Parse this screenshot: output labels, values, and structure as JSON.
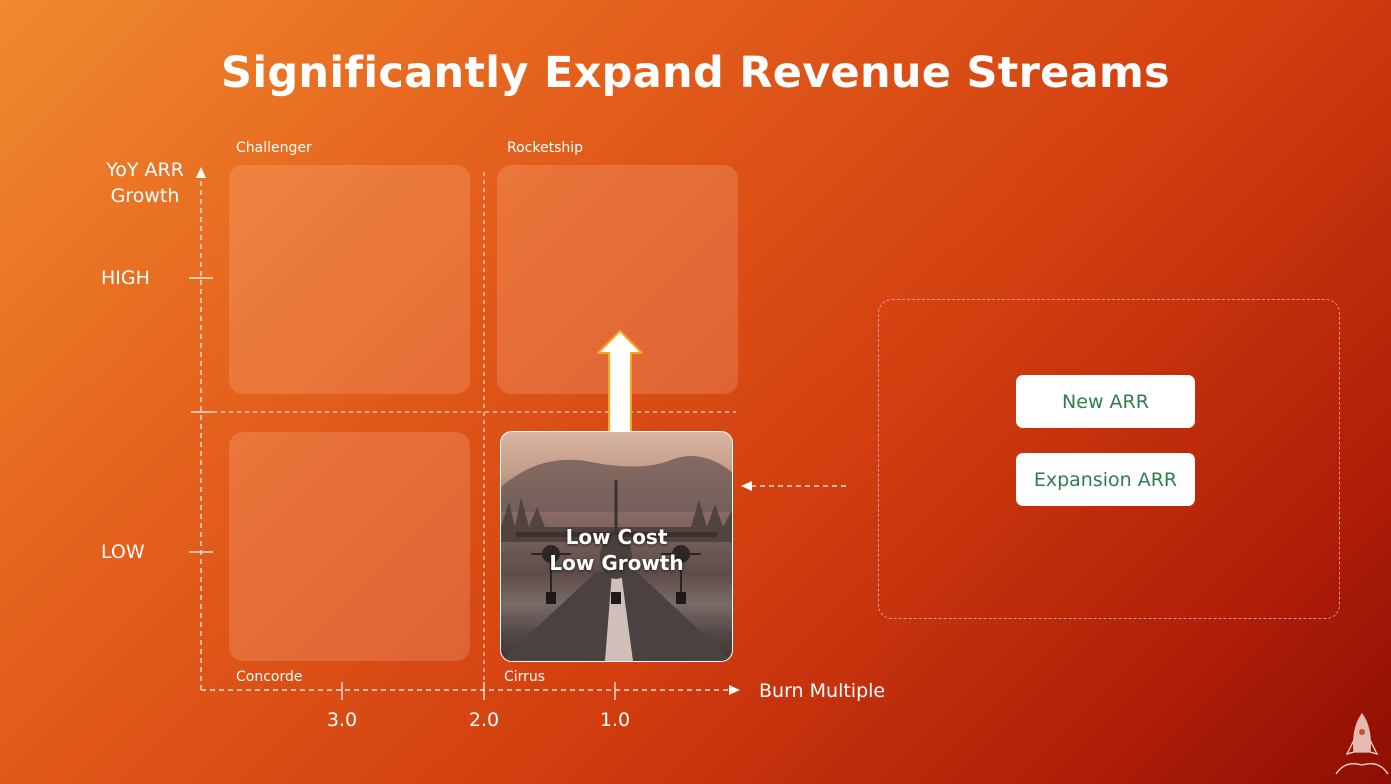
{
  "slide": {
    "title": "Significantly Expand Revenue Streams"
  },
  "matrix": {
    "y_axis_label_line1": "YoY ARR",
    "y_axis_label_line2": "Growth",
    "y_ticks": [
      "HIGH",
      "LOW"
    ],
    "x_axis_label": "Burn Multiple",
    "x_ticks": [
      "3.0",
      "2.0",
      "1.0"
    ],
    "quadrants": {
      "top_left": "Challenger",
      "top_right": "Rocketship",
      "bottom_left": "Concorde",
      "bottom_right": "Cirrus"
    },
    "highlight": {
      "line1": "Low Cost",
      "line2": "Low Growth"
    }
  },
  "revenue_box": {
    "items": [
      "New ARR",
      "Expansion ARR"
    ],
    "item_text_color": "#2e7d4f"
  },
  "colors": {
    "background_start": "#f08a2e",
    "background_end": "#8e0e04",
    "arrow_border": "#f5a623"
  },
  "icons": {
    "logo": "rocket-icon"
  }
}
